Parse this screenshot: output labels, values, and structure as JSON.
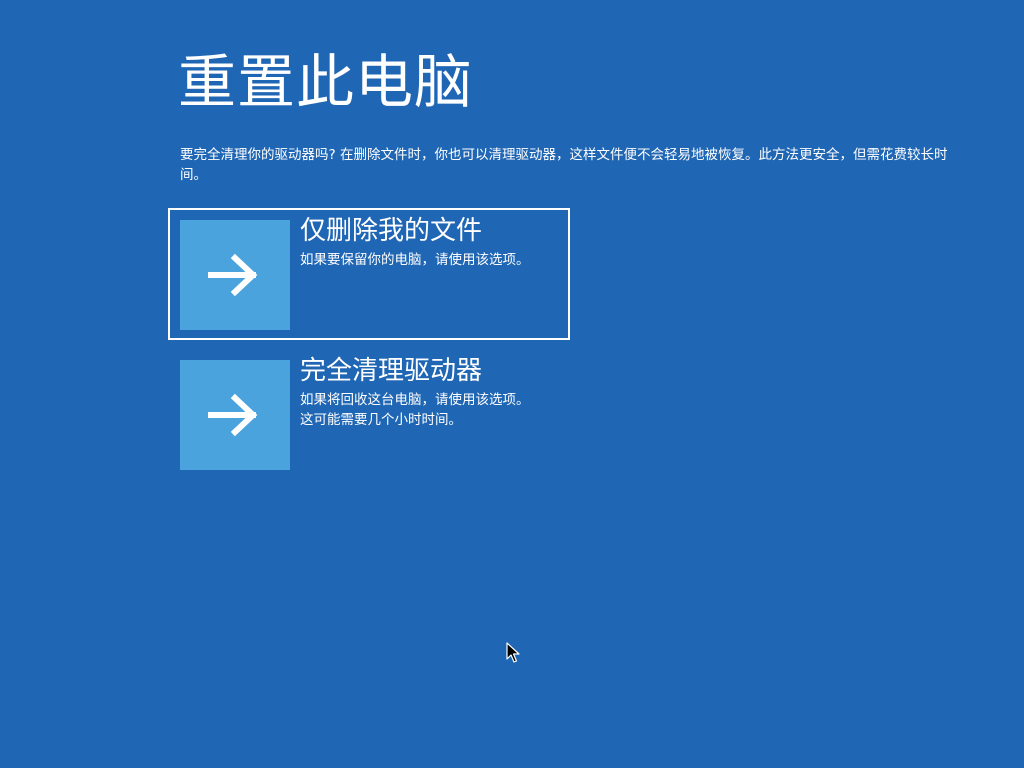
{
  "page": {
    "title": "重置此电脑",
    "description": "要完全清理你的驱动器吗? 在删除文件时，你也可以清理驱动器，这样文件便不会轻易地被恢复。此方法更安全，但需花费较长时间。"
  },
  "options": [
    {
      "title": "仅删除我的文件",
      "description": "如果要保留你的电脑，请使用该选项。",
      "icon": "arrow-right-icon",
      "focused": true
    },
    {
      "title": "完全清理驱动器",
      "description": "如果将回收这台电脑，请使用该选项。这可能需要几个小时时间。",
      "icon": "arrow-right-icon",
      "focused": false
    }
  ],
  "colors": {
    "background": "#1f66b4",
    "tile": "#4aa3dd",
    "text": "#ffffff",
    "focus_border": "#ffffff"
  }
}
